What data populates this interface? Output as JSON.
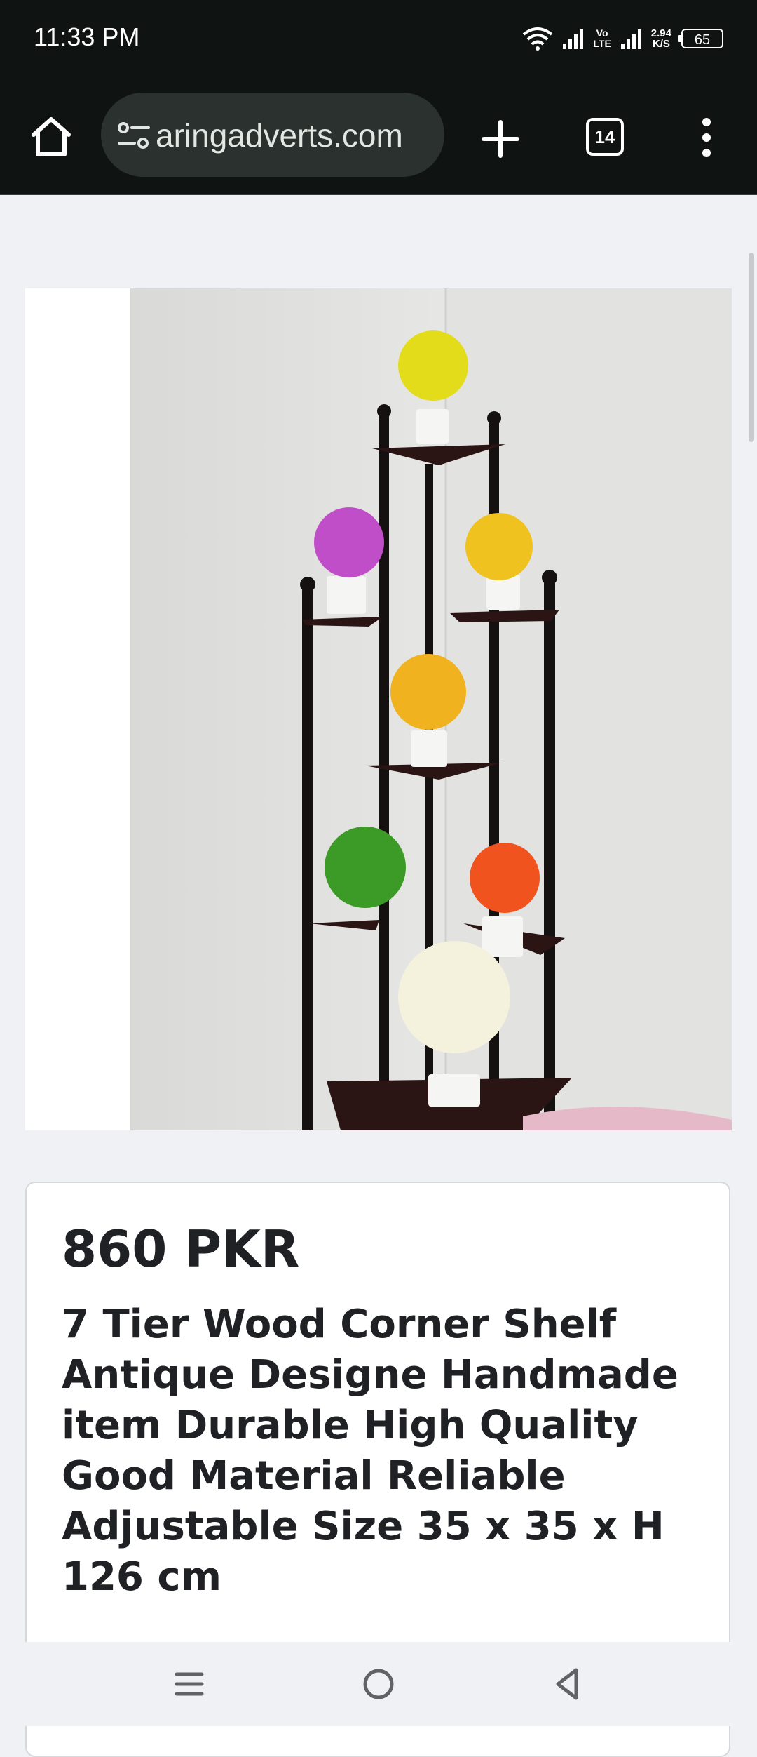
{
  "status": {
    "time": "11:33 PM",
    "network_label_top": "Vo",
    "network_label_bottom": "LTE",
    "speed_value": "2.94",
    "speed_unit": "K/S",
    "battery": "65"
  },
  "browser": {
    "url": "aringadverts.com",
    "tab_count": "14"
  },
  "product": {
    "price": "860 PKR",
    "title": "7 Tier Wood Corner Shelf Antique Designe Handmade item Durable High Quality Good Material Reliable Adjustable Size 35 x 35 x H 126 cm"
  },
  "colors": {
    "status_bg": "#0f1412",
    "url_bar_bg": "#2b312e",
    "page_bg": "#f0f1f5",
    "text": "#202124"
  },
  "icons": {
    "home": "home-icon",
    "site_settings": "tune-icon",
    "new_tab": "plus-icon",
    "tabs": "tab-switcher-icon",
    "menu": "more-vert-icon",
    "nav_recents": "menu-lines-icon",
    "nav_home": "circle-home-icon",
    "nav_back": "triangle-back-icon"
  }
}
